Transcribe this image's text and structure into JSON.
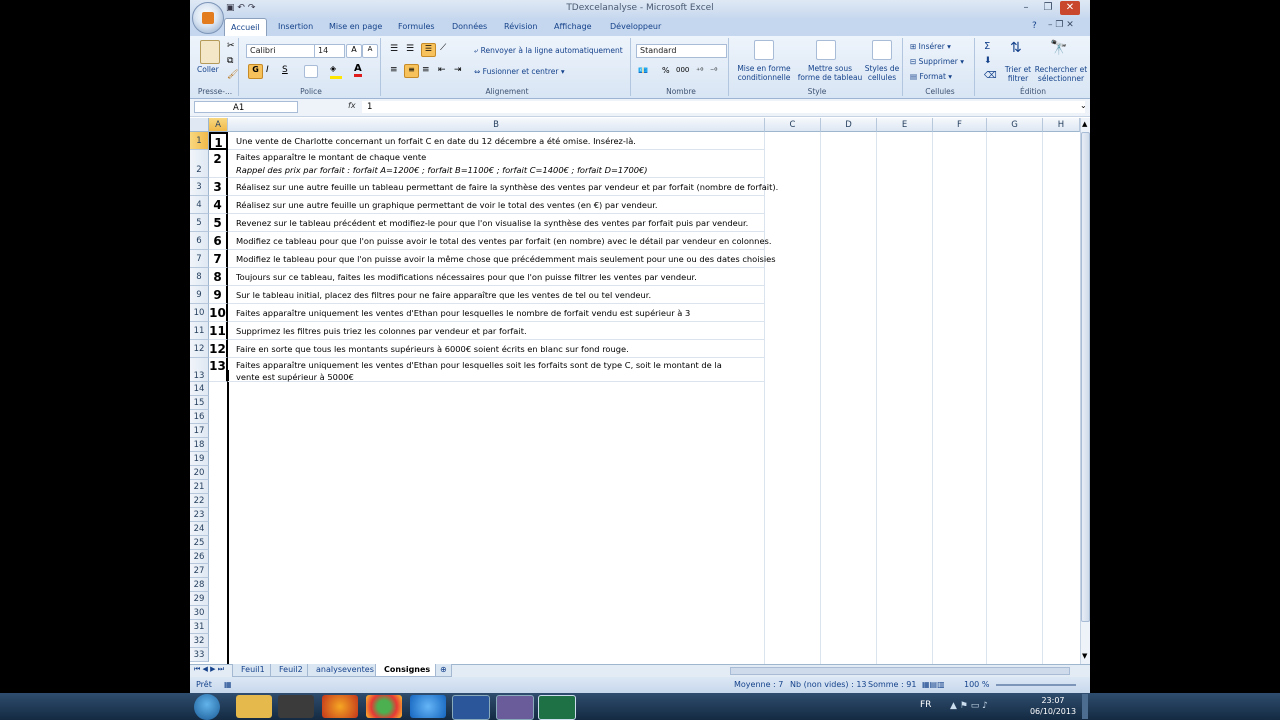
{
  "window": {
    "title": "TDexcelanalyse - Microsoft Excel"
  },
  "ribbon_tabs": [
    "Accueil",
    "Insertion",
    "Mise en page",
    "Formules",
    "Données",
    "Révision",
    "Affichage",
    "Développeur"
  ],
  "clipboard": {
    "paste": "Coller",
    "group": "Presse-..."
  },
  "font": {
    "name": "Calibri",
    "size": "14",
    "bold": "G",
    "italic": "I",
    "underline": "S",
    "group": "Police"
  },
  "alignment": {
    "wrap": "Renvoyer à la ligne automatiquement",
    "merge": "Fusionner et centrer",
    "group": "Alignement"
  },
  "number": {
    "format": "Standard",
    "group": "Nombre",
    "percent": "%",
    "thousands": "000"
  },
  "styles": {
    "conditional": "Mise en forme conditionnelle",
    "table": "Mettre sous forme de tableau",
    "cell_styles": "Styles de cellules",
    "group": "Style"
  },
  "cells": {
    "insert": "Insérer",
    "delete": "Supprimer",
    "format": "Format",
    "group": "Cellules"
  },
  "editing": {
    "sigma": "Σ",
    "sort": "Trier et filtrer",
    "find": "Rechercher et sélectionner",
    "group": "Édition"
  },
  "formula_bar": {
    "name_box": "A1",
    "fx": "fx",
    "value": "1"
  },
  "columns": [
    "A",
    "B",
    "C",
    "D",
    "E",
    "F",
    "G",
    "H"
  ],
  "rows": [
    {
      "n": "1",
      "a": "1",
      "b": "Une vente de Charlotte concernant un forfait C en date du 12 décembre a été omise. Insérez-là."
    },
    {
      "n": "2",
      "a": "2",
      "b": "Faites apparaître le montant de chaque vente",
      "b2": "Rappel des prix par forfait : forfait A=1200€ ; forfait B=1100€ ; forfait C=1400€ ; forfait D=1700€)"
    },
    {
      "n": "3",
      "a": "3",
      "b": "Réalisez sur une autre feuille un tableau permettant de faire la synthèse des ventes par vendeur et par forfait (nombre de forfait)."
    },
    {
      "n": "4",
      "a": "4",
      "b": "Réalisez sur une autre feuille un graphique permettant de voir le total des ventes (en €) par vendeur."
    },
    {
      "n": "5",
      "a": "5",
      "b": "Revenez sur le tableau précédent et modifiez-le pour que l'on visualise la synthèse des ventes par forfait puis par vendeur."
    },
    {
      "n": "6",
      "a": "6",
      "b": "Modifiez ce tableau pour que l'on puisse avoir le total des ventes par forfait (en nombre) avec le détail par vendeur en colonnes."
    },
    {
      "n": "7",
      "a": "7",
      "b": "Modifiez le tableau pour que l'on puisse avoir la même chose que précédemment mais seulement pour une ou des dates choisies"
    },
    {
      "n": "8",
      "a": "8",
      "b": "Toujours sur ce tableau, faites les modifications nécessaires pour que l'on puisse filtrer les ventes par vendeur."
    },
    {
      "n": "9",
      "a": "9",
      "b": "Sur le tableau initial, placez des filtres pour ne faire apparaître que les ventes de tel ou tel vendeur."
    },
    {
      "n": "10",
      "a": "10",
      "b": "Faites apparaître uniquement les ventes d'Ethan pour lesquelles le nombre de forfait vendu est supérieur à 3"
    },
    {
      "n": "11",
      "a": "11",
      "b": "Supprimez les filtres puis triez les colonnes par vendeur et par forfait."
    },
    {
      "n": "12",
      "a": "12",
      "b": "Faire en sorte que tous les montants supérieurs à 6000€ soient écrits en blanc sur fond rouge."
    },
    {
      "n": "13",
      "a": "13",
      "b": "Faites apparaître uniquement les ventes d'Ethan pour lesquelles soit les forfaits sont de type C, soit le montant de la",
      "b2": "vente est supérieur à 5000€"
    }
  ],
  "empty_rows": [
    "14",
    "15",
    "16",
    "17",
    "18",
    "19",
    "20",
    "21",
    "22",
    "23",
    "24",
    "25",
    "26",
    "27",
    "28",
    "29",
    "30",
    "31",
    "32",
    "33"
  ],
  "sheets": [
    "Feuil1",
    "Feuil2",
    "analyseventes",
    "Consignes"
  ],
  "status": {
    "ready": "Prêt",
    "avg": "Moyenne : 7",
    "count": "Nb (non vides) : 13",
    "sum": "Somme : 91",
    "zoom": "100 %"
  },
  "taskbar": {
    "lang": "FR",
    "time": "23:07",
    "date": "06/10/2013"
  }
}
